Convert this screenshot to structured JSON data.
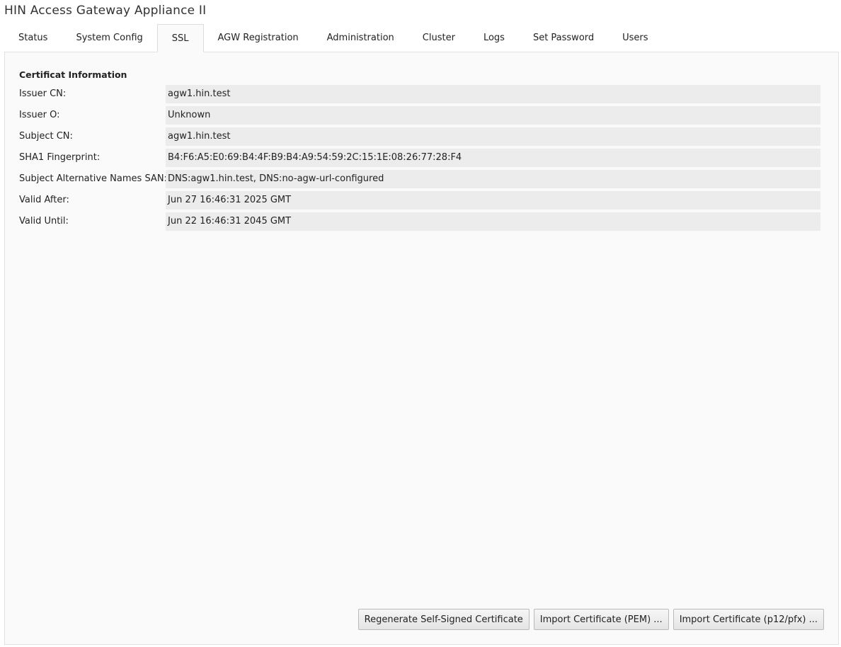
{
  "app": {
    "title": "HIN Access Gateway Appliance II"
  },
  "tabs": [
    {
      "label": "Status"
    },
    {
      "label": "System Config"
    },
    {
      "label": "SSL",
      "active": true
    },
    {
      "label": "AGW Registration"
    },
    {
      "label": "Administration"
    },
    {
      "label": "Cluster"
    },
    {
      "label": "Logs"
    },
    {
      "label": "Set Password"
    },
    {
      "label": "Users"
    }
  ],
  "certificate": {
    "title": "Certificat Information",
    "fields": [
      {
        "label": "Issuer CN:",
        "value": "agw1.hin.test"
      },
      {
        "label": "Issuer O:",
        "value": "Unknown"
      },
      {
        "label": "Subject CN:",
        "value": "agw1.hin.test"
      },
      {
        "label": "SHA1 Fingerprint:",
        "value": "B4:F6:A5:E0:69:B4:4F:B9:B4:A9:54:59:2C:15:1E:08:26:77:28:F4"
      },
      {
        "label": "Subject Alternative Names SAN:",
        "value": "DNS:agw1.hin.test, DNS:no-agw-url-configured"
      },
      {
        "label": "Valid After:",
        "value": "Jun 27 16:46:31 2025 GMT"
      },
      {
        "label": "Valid Until:",
        "value": "Jun 22 16:46:31 2045 GMT"
      }
    ]
  },
  "actions": {
    "regenerate_label": "Regenerate Self-Signed Certificate",
    "import_pem_label": "Import Certificate (PEM) ...",
    "import_p12_label": "Import Certificate (p12/pfx) ..."
  },
  "colors": {
    "panel_bg": "#fafafa",
    "field_bg": "#ececec",
    "border": "#dcdcdc"
  }
}
